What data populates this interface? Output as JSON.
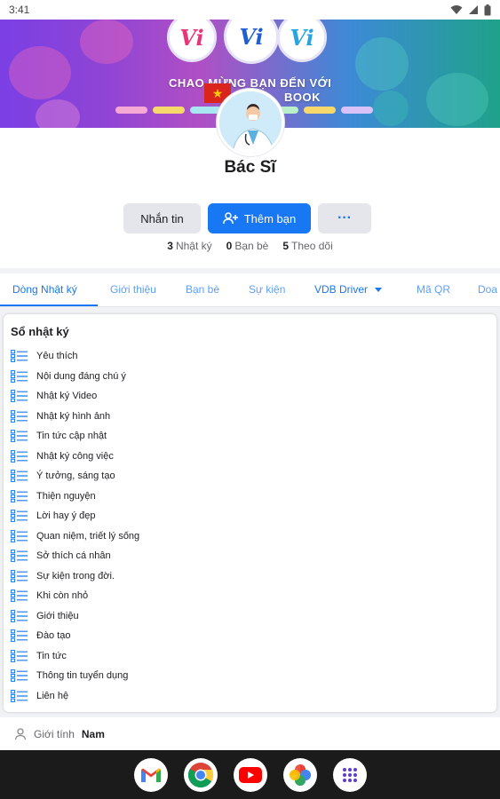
{
  "status_bar": {
    "time": "3:41"
  },
  "cover": {
    "logo_letters": [
      "Vi",
      "Vi",
      "Vi"
    ],
    "banner_line1": "CHAO MỪNG BẠN ĐẾN VỚI",
    "banner_line2": "BOOK",
    "colors": [
      "#7b3fe4",
      "#3d8ad6",
      "#1fa28a"
    ]
  },
  "profile": {
    "name": "Bác Sĩ",
    "buttons": {
      "message": "Nhắn tin",
      "add_friend": "Thêm bạn",
      "more": "···"
    },
    "stats": [
      {
        "count": "3",
        "label": "Nhật ký"
      },
      {
        "count": "0",
        "label": "Bạn bè"
      },
      {
        "count": "5",
        "label": "Theo dõi"
      }
    ]
  },
  "tabs": [
    {
      "label": "Dòng Nhật ký",
      "active": true
    },
    {
      "label": "Giới thiệu"
    },
    {
      "label": "Bạn bè"
    },
    {
      "label": "Sự kiện"
    },
    {
      "label": "VDB Driver"
    },
    {
      "label": "Mã QR"
    },
    {
      "label": "Doa"
    }
  ],
  "diary": {
    "title": "Sổ nhật ký",
    "items": [
      "Yêu thích",
      "Nội dung đáng chú ý",
      "Nhật ký Video",
      "Nhật ký hình ảnh",
      "Tin tức cập nhật",
      "Nhật ký công việc",
      "Ý tưởng, sáng tạo",
      "Thiện nguyện",
      "Lời hay ý đẹp",
      "Quan niệm, triết lý sống",
      "Sở thích cá nhân",
      "Sự kiện trong đời.",
      "Khi còn nhỏ",
      "Giới thiệu",
      "Đào tạo",
      "Tin tức",
      "Thông tin tuyển dụng",
      "Liên hệ"
    ]
  },
  "about": {
    "gender_label": "Giới tính",
    "gender_value": "Nam"
  },
  "dock": {
    "apps": [
      "gmail-icon",
      "chrome-icon",
      "youtube-icon",
      "photos-icon",
      "app-drawer-icon"
    ]
  },
  "accent_color": "#1877f2"
}
